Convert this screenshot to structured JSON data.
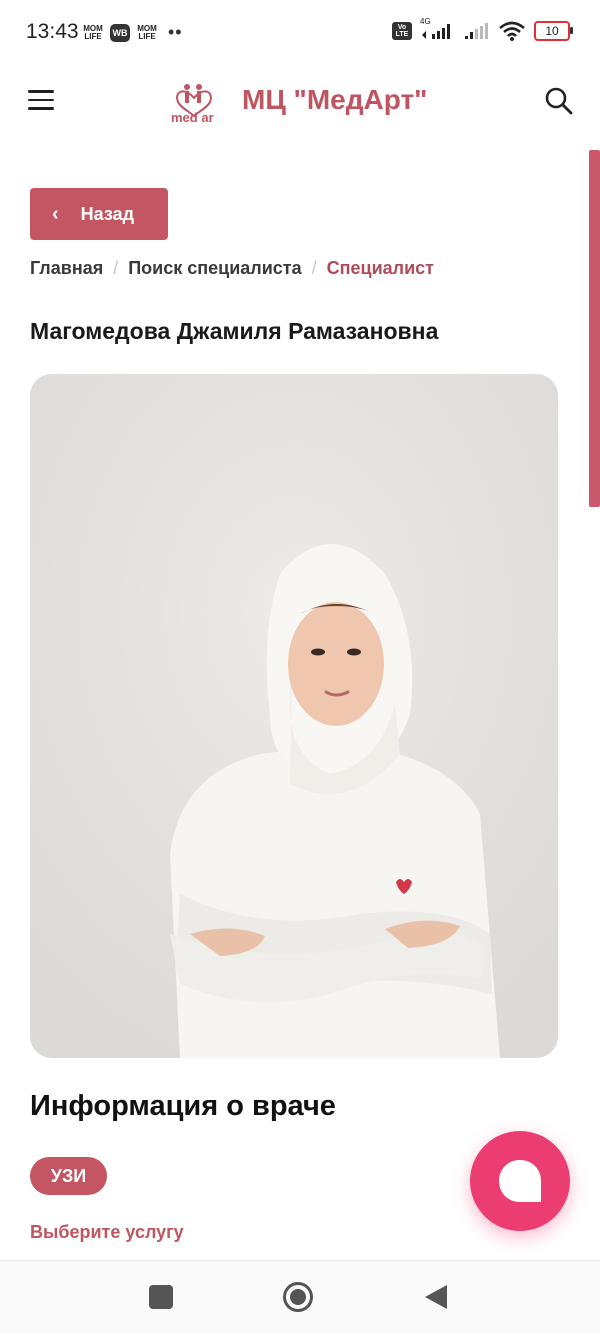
{
  "status_bar": {
    "time": "13:43",
    "app_badge_1": "MOM LIFE",
    "app_badge_2": "WB",
    "app_badge_3": "MOM LIFE",
    "volte": "Vo LTE",
    "network": "4G",
    "battery": "10",
    "battery_color": "#e03030"
  },
  "header": {
    "brand": "МЦ \"МедАрт\"",
    "logo_text": "med ar",
    "brand_color": "#c05562"
  },
  "back_button": {
    "label": "Назад"
  },
  "breadcrumb": {
    "items": [
      "Главная",
      "Поиск специалиста",
      "Специалист"
    ],
    "separator": "/"
  },
  "doctor": {
    "name": "Магомедова Джамиля Рамазановна"
  },
  "info": {
    "title": "Информация о враче",
    "tag": "УЗИ",
    "service_link": "Выберите услугу"
  },
  "colors": {
    "accent": "#c45664",
    "fab": "#ec3d73"
  }
}
